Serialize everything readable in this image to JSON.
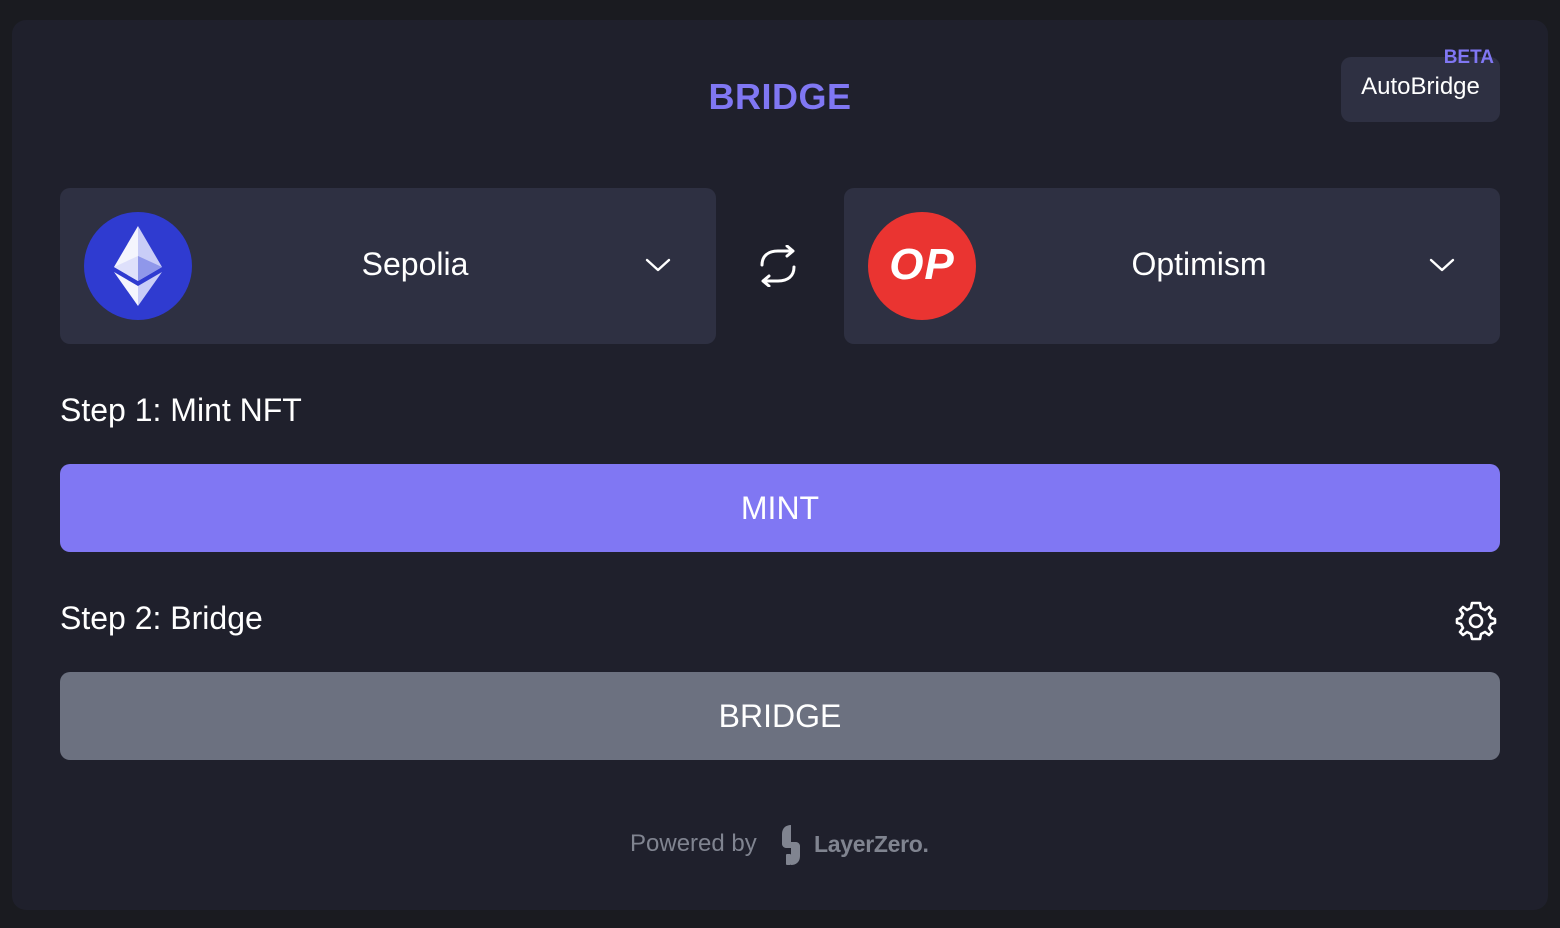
{
  "header": {
    "title": "BRIDGE",
    "autobridge_label": "AutoBridge",
    "beta_badge": "BETA"
  },
  "chains": {
    "from": {
      "name": "Sepolia",
      "icon": "ethereum-icon"
    },
    "to": {
      "name": "Optimism",
      "icon": "optimism-icon",
      "logo_text": "OP"
    }
  },
  "steps": {
    "step1_label": "Step 1: Mint NFT",
    "mint_label": "MINT",
    "step2_label": "Step 2: Bridge",
    "bridge_label": "BRIDGE"
  },
  "footer": {
    "powered_by": "Powered by",
    "brand": "LayerZero."
  },
  "colors": {
    "accent": "#8077f3",
    "card_bg": "#1f202c",
    "panel_bg": "#2e3042",
    "disabled_button": "#6c7180",
    "ethereum": "#2f3bd0",
    "optimism": "#ea3431"
  }
}
